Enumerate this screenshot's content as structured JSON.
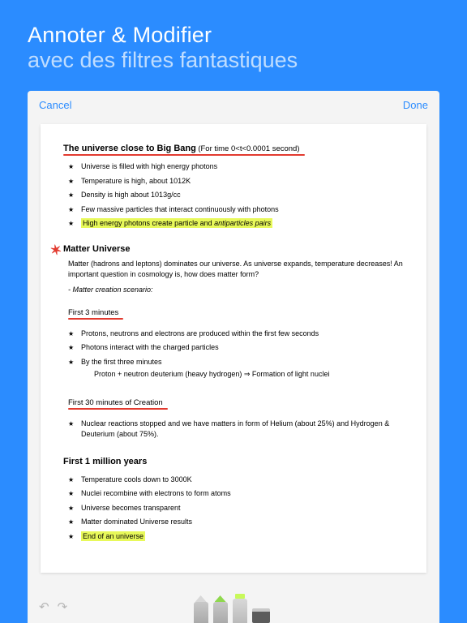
{
  "promo": {
    "title": "Annoter & Modifier",
    "subtitle": "avec des filtres fantastiques"
  },
  "toolbar": {
    "cancel": "Cancel",
    "done": "Done"
  },
  "doc": {
    "h1": "The universe close to Big Bang",
    "h1_sub": "(For time 0<t<0.0001 second)",
    "list1": [
      "Universe is filled with high energy photons",
      "Temperature is high, about 1012K",
      "Density is high about 1013g/cc",
      "Few massive particles that interact continuously with photons"
    ],
    "list1_hl_a": "High energy photons create particle and ",
    "list1_hl_b": "antiparticles pairs",
    "h2": "Matter Universe",
    "matter_para": "Matter  (hadrons and leptons)  dominates our universe. As universe expands, temperature decreases! An important question in cosmology is, how does matter form?",
    "scenario": "- Matter creation scenario:",
    "sub1": "First 3 minutes",
    "list2": [
      "Protons, neutrons and electrons are produced within the first few seconds",
      "Photons interact with the charged particles",
      "By the first three minutes"
    ],
    "list2_extra": "Proton + neutron deuterium (heavy hydrogen) ⇒ Formation of light nuclei",
    "sub2": "First 30 minutes of Creation",
    "list3": [
      "Nuclear reactions stopped and we have matters in form of Helium (about 25%) and Hydrogen & Deuterium (about 75%)."
    ],
    "h3": "First 1 million years",
    "list4": [
      "Temperature cools down to 3000K",
      "Nuclei recombine with electrons to form atoms",
      "Universe becomes transparent",
      "Matter dominated Universe results"
    ],
    "list4_hl": "End of an universe"
  },
  "tools": {
    "undo": "↶",
    "redo": "↷"
  }
}
